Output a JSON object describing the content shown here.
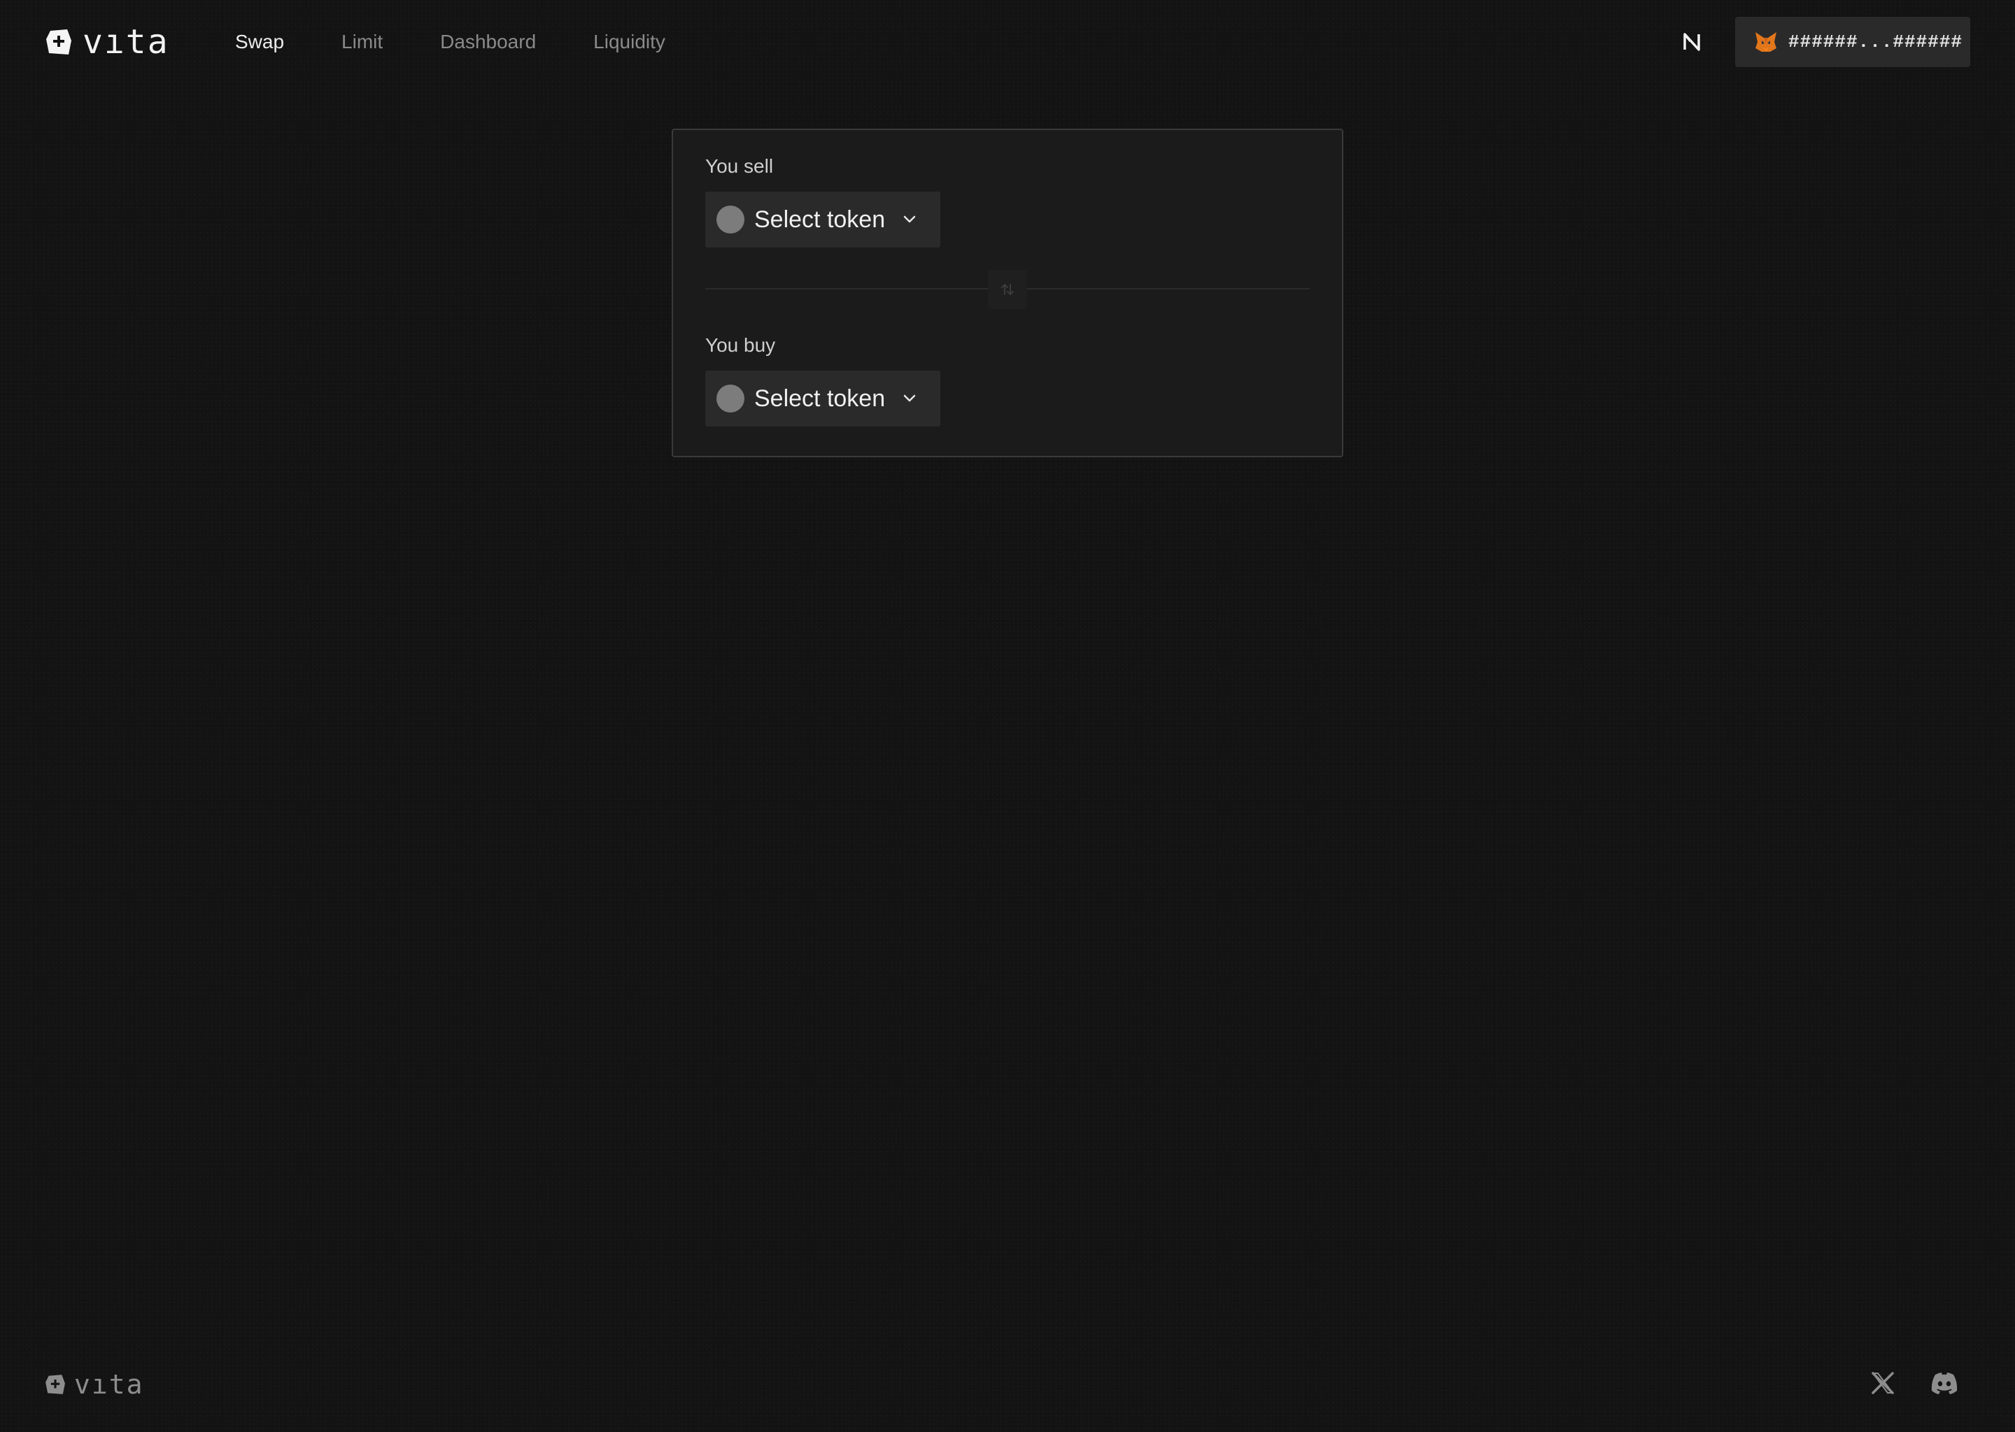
{
  "header": {
    "logo_text": "vıta",
    "nav": [
      {
        "label": "Swap",
        "active": true
      },
      {
        "label": "Limit",
        "active": false
      },
      {
        "label": "Dashboard",
        "active": false
      },
      {
        "label": "Liquidity",
        "active": false
      }
    ],
    "network_icon": "near-icon",
    "wallet": {
      "icon": "metamask-fox-icon",
      "address": "######...######"
    }
  },
  "swap": {
    "sell": {
      "label": "You sell",
      "token_label": "Select token"
    },
    "switch_icon": "swap-arrows-icon",
    "buy": {
      "label": "You buy",
      "token_label": "Select token"
    }
  },
  "footer": {
    "logo_text": "vıta",
    "social": [
      "x-icon",
      "discord-icon"
    ]
  },
  "colors": {
    "background": "#131313",
    "card": "#1b1b1b",
    "card_border": "#3a3a3a",
    "button_bg": "#2a2a2a",
    "token_placeholder": "#7c7c7c",
    "text_primary": "#ececec",
    "text_muted": "#8a8a8a",
    "fox_orange": "#e2761b"
  }
}
